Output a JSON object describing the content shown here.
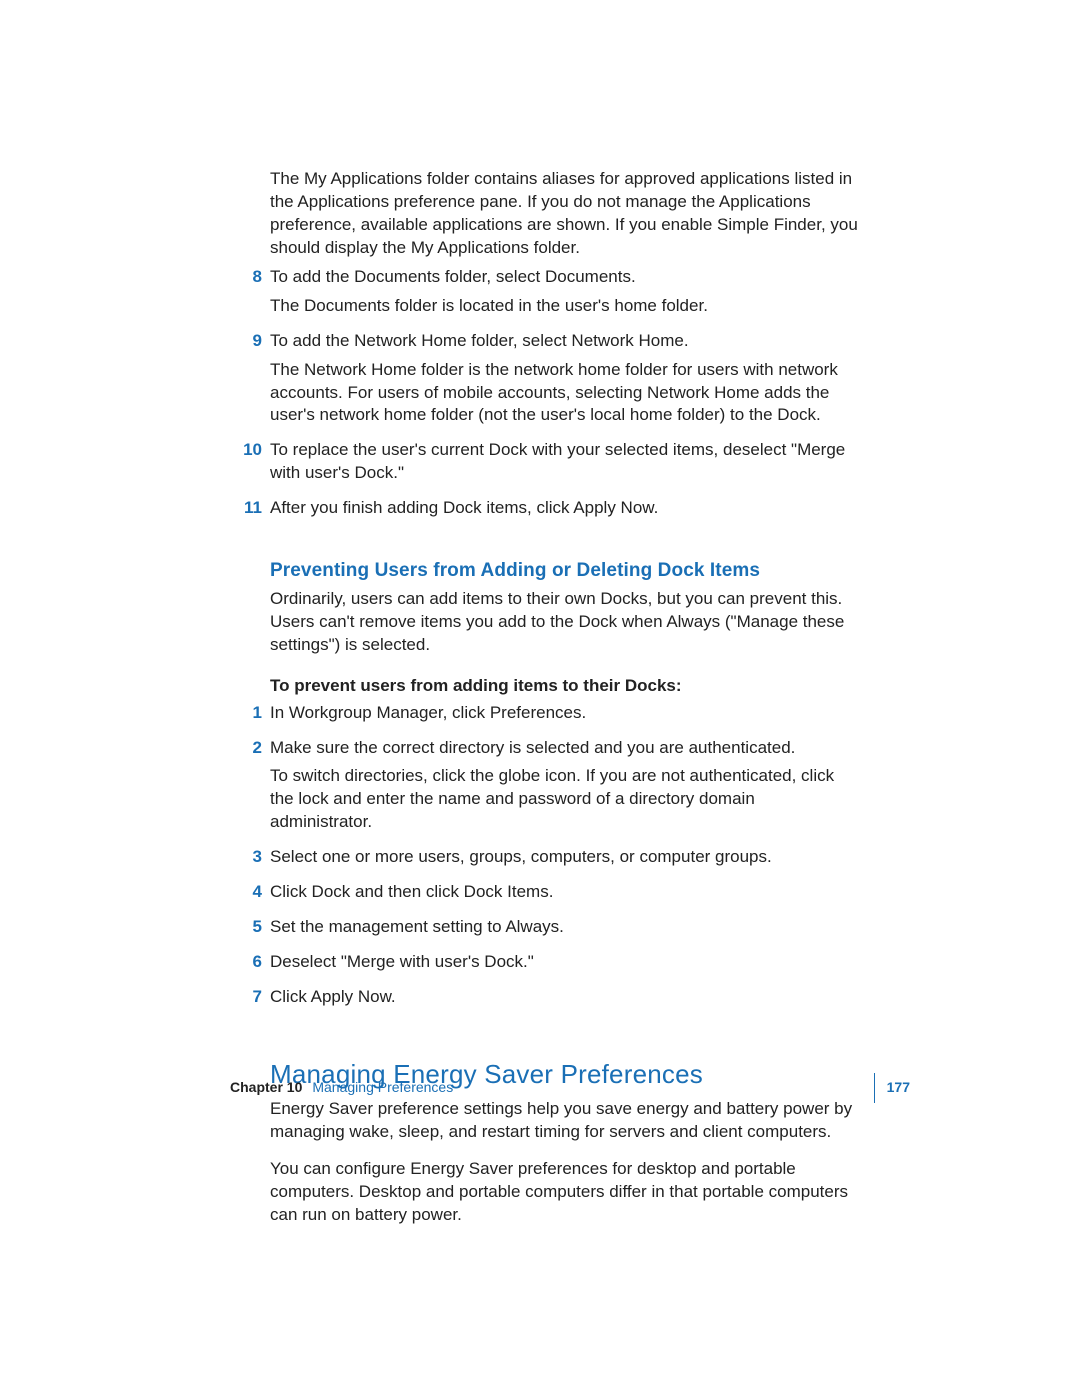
{
  "intro_para": "The My Applications folder contains aliases for approved applications listed in the Applications preference pane. If you do not manage the Applications preference, available applications are shown. If you enable Simple Finder, you should display the My Applications folder.",
  "steps_a": [
    {
      "num": "8",
      "lines": [
        "To add the Documents folder, select Documents.",
        "The Documents folder is located in the user's home folder."
      ]
    },
    {
      "num": "9",
      "lines": [
        "To add the Network Home folder, select Network Home.",
        "The Network Home folder is the network home folder for users with network accounts. For users of mobile accounts, selecting Network Home adds the user's network home folder (not the user's local home folder) to the Dock."
      ]
    },
    {
      "num": "10",
      "lines": [
        "To replace the user's current Dock with your selected items, deselect \"Merge with user's Dock.\""
      ]
    },
    {
      "num": "11",
      "lines": [
        "After you finish adding Dock items, click Apply Now."
      ]
    }
  ],
  "sub_heading": "Preventing Users from Adding or Deleting Dock Items",
  "sub_heading_para": "Ordinarily, users can add items to their own Docks, but you can prevent this. Users can't remove items you add to the Dock when Always (\"Manage these settings\") is selected.",
  "bold_line": "To prevent users from adding items to their Docks:",
  "steps_b": [
    {
      "num": "1",
      "lines": [
        "In Workgroup Manager, click Preferences."
      ]
    },
    {
      "num": "2",
      "lines": [
        "Make sure the correct directory is selected and you are authenticated.",
        "To switch directories, click the globe icon. If you are not authenticated, click the lock and enter the name and password of a directory domain administrator."
      ]
    },
    {
      "num": "3",
      "lines": [
        "Select one or more users, groups, computers, or computer groups."
      ]
    },
    {
      "num": "4",
      "lines": [
        "Click Dock and then click Dock Items."
      ]
    },
    {
      "num": "5",
      "lines": [
        "Set the management setting to Always."
      ]
    },
    {
      "num": "6",
      "lines": [
        "Deselect \"Merge with user's Dock.\""
      ]
    },
    {
      "num": "7",
      "lines": [
        "Click Apply Now."
      ]
    }
  ],
  "section_heading": "Managing Energy Saver Preferences",
  "section_paras": [
    "Energy Saver preference settings help you save energy and battery power by managing wake, sleep, and restart timing for servers and client computers.",
    "You can configure Energy Saver preferences for desktop and portable computers. Desktop and portable computers differ in that portable computers can run on battery power."
  ],
  "footer": {
    "chapter_label": "Chapter 10",
    "chapter_title": "Managing Preferences",
    "page_number": "177"
  }
}
